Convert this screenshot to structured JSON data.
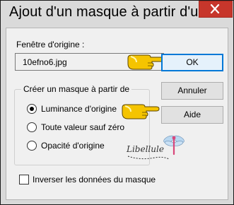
{
  "window": {
    "title": "Ajout d'un masque à partir d'u..."
  },
  "source": {
    "label": "Fenêtre d'origine :",
    "value": "10efno6.jpg"
  },
  "buttons": {
    "ok": "OK",
    "cancel": "Annuler",
    "help": "Aide"
  },
  "group": {
    "title": "Créer un masque à partir de",
    "options": [
      {
        "label": "Luminance d'origine",
        "checked": true
      },
      {
        "label": "Toute valeur sauf zéro",
        "checked": false
      },
      {
        "label": "Opacité d'origine",
        "checked": false
      }
    ]
  },
  "invert": {
    "label": "Inverser les données du masque",
    "checked": false
  },
  "watermark": {
    "text": "Libellule"
  },
  "colors": {
    "close": "#c7362b",
    "accent": "#0078d7",
    "hand": "#f5c400"
  }
}
